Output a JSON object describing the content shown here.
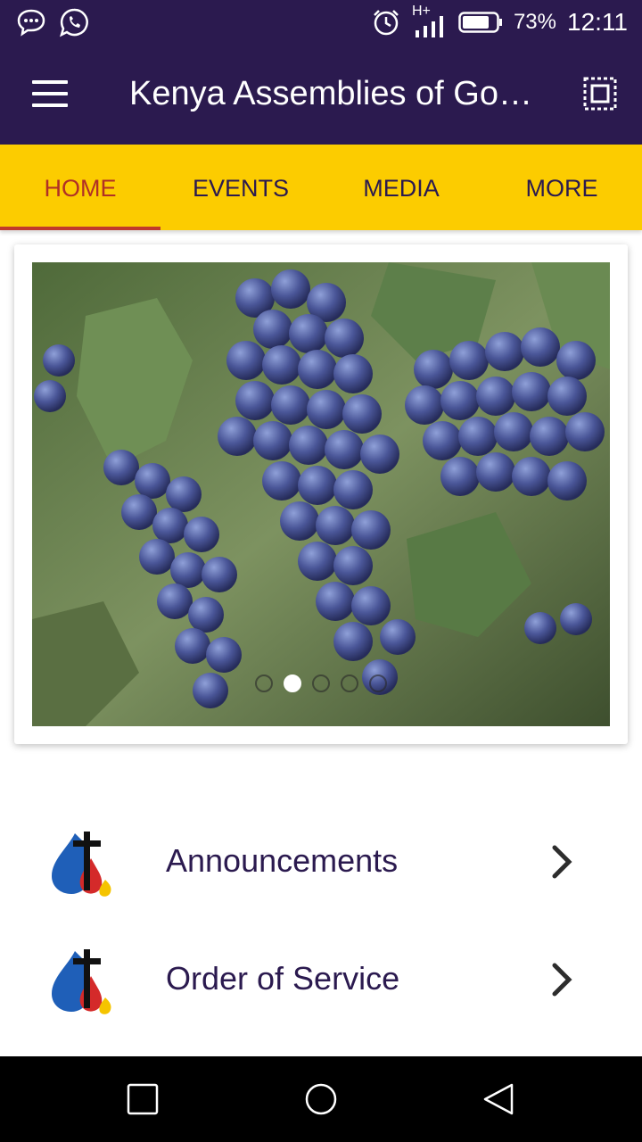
{
  "status_bar": {
    "icons": [
      "messages-icon",
      "whatsapp-icon",
      "alarm-icon",
      "signal-icon",
      "battery-icon"
    ],
    "network": "H+",
    "battery": "73%",
    "time": "12:11"
  },
  "app_bar": {
    "title": "Kenya Assemblies of Go…"
  },
  "tabs": [
    {
      "label": "HOME",
      "active": true
    },
    {
      "label": "EVENTS",
      "active": false
    },
    {
      "label": "MEDIA",
      "active": false
    },
    {
      "label": "MORE",
      "active": false
    }
  ],
  "carousel": {
    "image": "grapes-photo",
    "slide_count": 5,
    "active_index": 1
  },
  "list": [
    {
      "label": "Announcements",
      "icon": "church-logo-icon"
    },
    {
      "label": "Order of Service",
      "icon": "church-logo-icon"
    }
  ],
  "nav_bar": {
    "icons": [
      "recent-apps-icon",
      "home-icon",
      "back-icon"
    ]
  },
  "colors": {
    "primary": "#2b1a4f",
    "accent": "#fccc00",
    "active_tab": "#b03026"
  }
}
